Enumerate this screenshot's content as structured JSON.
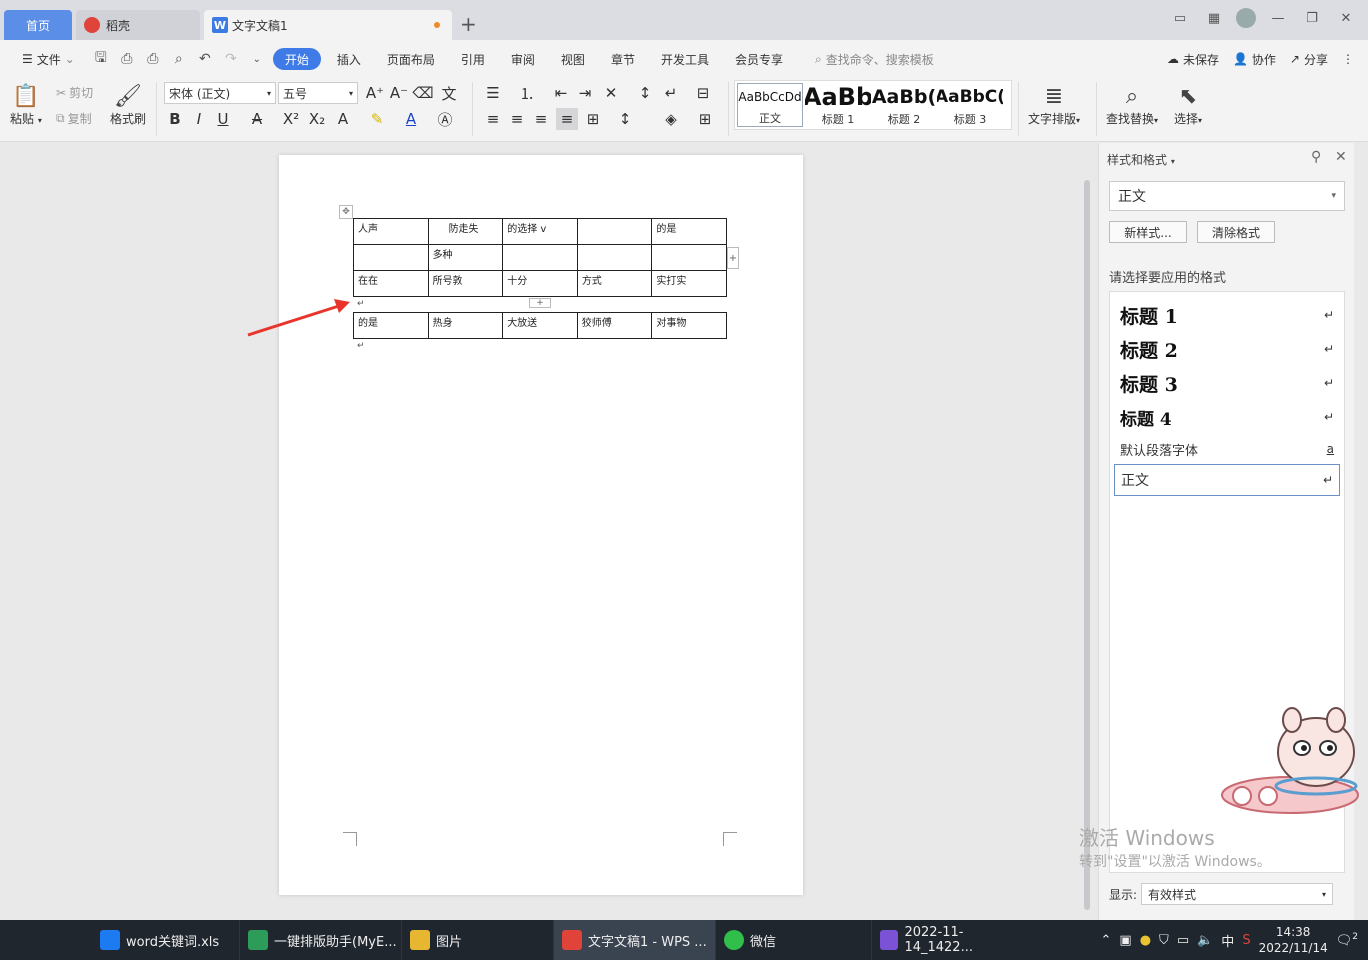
{
  "tabs": {
    "home": "首页",
    "daoke": "稻壳",
    "doc": "文字文稿1",
    "add": "+"
  },
  "menu": {
    "file": "文件",
    "items": [
      "开始",
      "插入",
      "页面布局",
      "引用",
      "审阅",
      "视图",
      "章节",
      "开发工具",
      "会员专享"
    ],
    "search": "查找命令、搜索模板",
    "unsaved": "未保存",
    "collab": "协作",
    "share": "分享"
  },
  "ribbon": {
    "paste": "粘贴",
    "cut": "剪切",
    "copy": "复制",
    "format_painter": "格式刷",
    "font_name": "宋体 (正文)",
    "font_size": "五号",
    "styles": [
      {
        "preview": "AaBbCcDd",
        "label": "正文"
      },
      {
        "preview": "AaBb",
        "label": "标题 1"
      },
      {
        "preview": "AaBb(",
        "label": "标题 2"
      },
      {
        "preview": "AaBbC(",
        "label": "标题 3"
      }
    ],
    "text_layout": "文字排版",
    "find_replace": "查找替换",
    "select": "选择"
  },
  "table1": [
    [
      "人声",
      "防走失",
      "的选择 v",
      "",
      "的是"
    ],
    [
      "",
      "多种",
      "",
      "",
      ""
    ],
    [
      "在在",
      "所号敦",
      "十分",
      "方式",
      "实打实"
    ]
  ],
  "table2": [
    [
      "的是",
      "热身",
      "大放送",
      "狡师傅",
      "对事物"
    ]
  ],
  "panel": {
    "title": "样式和格式",
    "current_style": "正文",
    "new_style": "新样式...",
    "clear_format": "清除格式",
    "hint": "请选择要应用的格式",
    "styles": [
      {
        "label": "标题  1",
        "mark": "↵"
      },
      {
        "label": "标题  2",
        "mark": "↵"
      },
      {
        "label": "标题  3",
        "mark": "↵"
      },
      {
        "label": "标题  4",
        "mark": "↵"
      },
      {
        "label": "默认段落字体",
        "mark": "a"
      },
      {
        "label": "正文",
        "mark": "↵"
      }
    ],
    "display_label": "显示:",
    "display_value": "有效样式"
  },
  "activate": {
    "line1": "激活 Windows",
    "line2": "转到\"设置\"以激活 Windows。"
  },
  "taskbar": {
    "items": [
      "word关键词.xls",
      "一键排版助手(MyE...",
      "图片",
      "文字文稿1 - WPS ...",
      "微信",
      "2022-11-14_1422..."
    ],
    "ime": "中",
    "time": "14:38",
    "date": "2022/11/14",
    "notif_count": "2"
  },
  "colors": {
    "accent": "#3e7be6",
    "arrow": "#e8352b"
  }
}
